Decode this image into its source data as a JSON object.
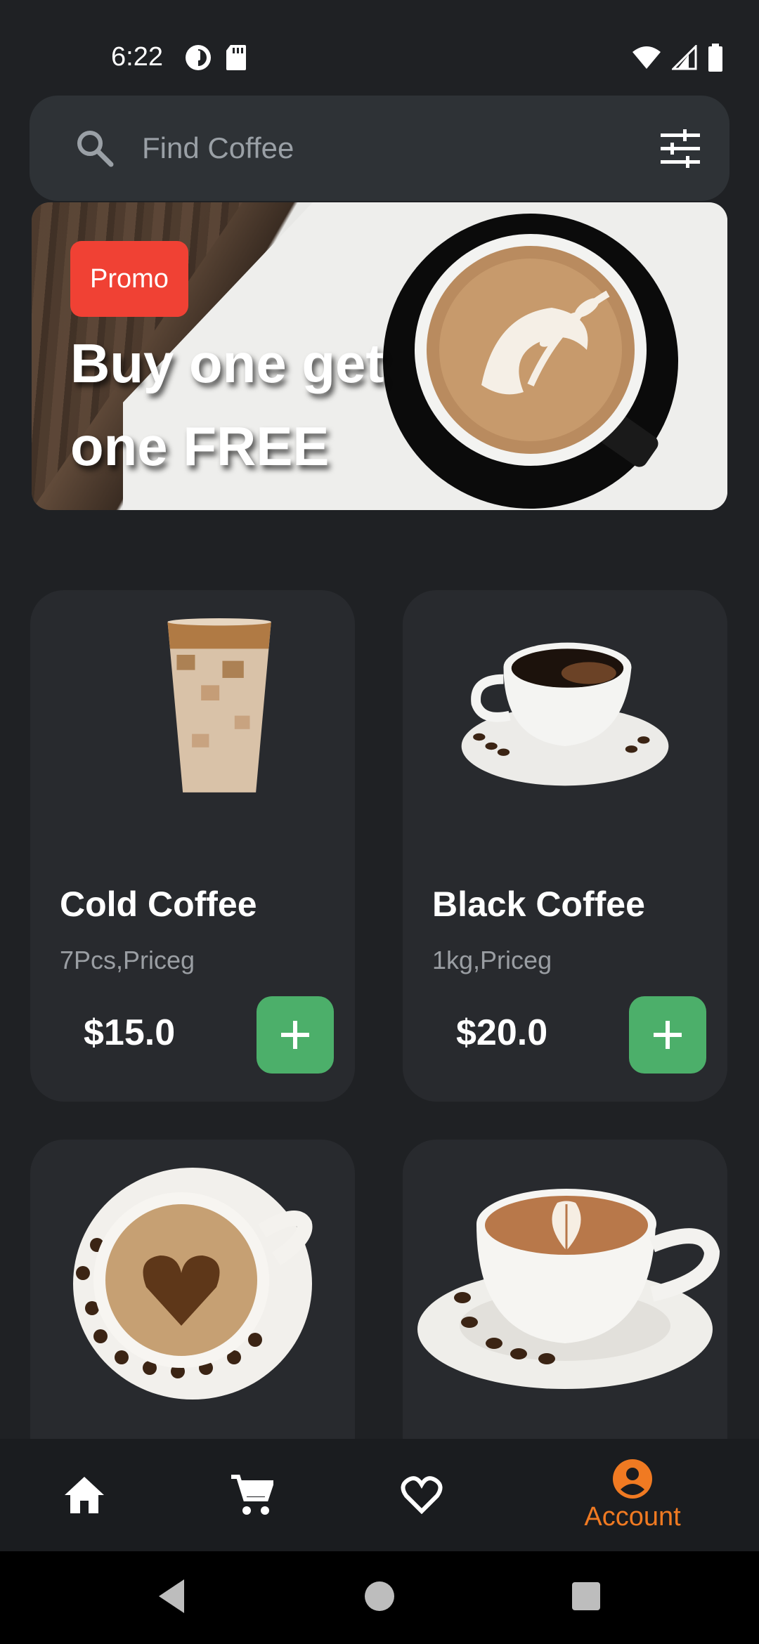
{
  "status_bar": {
    "time": "6:22",
    "left_icons": [
      "data-saver-icon",
      "sd-card-icon"
    ],
    "right_icons": [
      "wifi-icon",
      "signal-icon",
      "battery-icon"
    ]
  },
  "search": {
    "placeholder": "Find Coffee",
    "value": ""
  },
  "promo": {
    "badge": "Promo",
    "headline_line1": "Buy one get",
    "headline_line2": "one FREE",
    "badge_color": "#f04134"
  },
  "products": [
    {
      "name": "Cold Coffee",
      "description": "7Pcs,Priceg",
      "price": "$15.0",
      "image": "iced-coffee-glass"
    },
    {
      "name": "Black Coffee",
      "description": "1kg,Priceg",
      "price": "$20.0",
      "image": "black-coffee-cup"
    },
    {
      "name": "",
      "description": "",
      "price": "",
      "image": "heart-latte-cup"
    },
    {
      "name": "",
      "description": "",
      "price": "",
      "image": "cappuccino-cup"
    }
  ],
  "bottom_nav": {
    "items": [
      {
        "icon": "home-icon",
        "label": ""
      },
      {
        "icon": "cart-icon",
        "label": ""
      },
      {
        "icon": "heart-icon",
        "label": ""
      },
      {
        "icon": "account-icon",
        "label": "Account"
      }
    ],
    "active_color": "#f07a22"
  },
  "colors": {
    "background": "#1f2124",
    "card": "#282a2e",
    "add_button": "#4caf6a",
    "accent": "#f07a22"
  }
}
